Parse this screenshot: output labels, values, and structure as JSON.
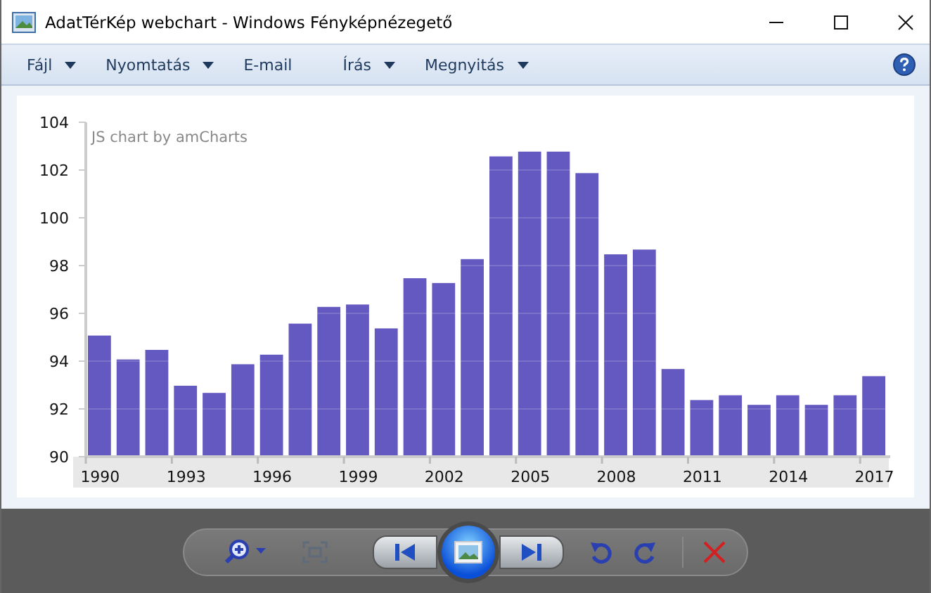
{
  "window": {
    "title": "AdatTérKép webchart - Windows Fényképnézegető"
  },
  "menu": [
    {
      "label": "Fájl",
      "dropdown": true
    },
    {
      "label": "Nyomtatás",
      "dropdown": true
    },
    {
      "label": "E-mail",
      "dropdown": false
    },
    {
      "label": "Írás",
      "dropdown": true
    },
    {
      "label": "Megnyitás",
      "dropdown": true
    }
  ],
  "image": {
    "credit": "JS chart by amCharts",
    "chart_data": {
      "type": "bar",
      "x": [
        1990,
        1991,
        1992,
        1993,
        1994,
        1995,
        1996,
        1997,
        1998,
        1999,
        2000,
        2001,
        2002,
        2003,
        2004,
        2005,
        2006,
        2007,
        2008,
        2009,
        2010,
        2011,
        2012,
        2013,
        2014,
        2015,
        2016,
        2017
      ],
      "grid": true,
      "xlim": [
        1989.5,
        2017.5
      ],
      "values": [
        95.1,
        94.1,
        94.5,
        93.0,
        92.7,
        93.9,
        94.3,
        95.6,
        96.3,
        96.4,
        95.4,
        97.5,
        97.3,
        98.3,
        102.6,
        102.8,
        102.8,
        101.9,
        98.5,
        98.7,
        93.7,
        92.4,
        92.6,
        92.2,
        92.6,
        92.2,
        92.6,
        93.4
      ],
      "ylim": [
        90,
        104
      ],
      "yticks": [
        90,
        92,
        94,
        96,
        98,
        100,
        102,
        104
      ],
      "xticks": [
        1990,
        1993,
        1996,
        1999,
        2002,
        2005,
        2008,
        2011,
        2014,
        2017
      ]
    }
  }
}
